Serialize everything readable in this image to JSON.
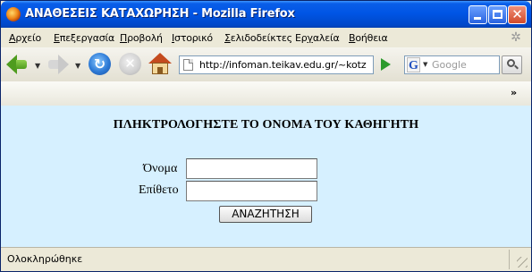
{
  "window": {
    "title": "ΑΝΑΘΕΣΕΙΣ ΚΑΤΑΧΩΡΗΣΗ - Mozilla Firefox",
    "buttons": {
      "minimize_icon": "minimize-icon",
      "maximize_icon": "maximize-icon",
      "close_icon": "close-icon"
    }
  },
  "menubar": {
    "items": [
      {
        "label": "Αρχείο",
        "u": "Α",
        "rest": "ρχείο"
      },
      {
        "label": "Επεξεργασία",
        "u": "Ε",
        "rest": "πεξεργασία"
      },
      {
        "label": "Προβολή",
        "u": "Π",
        "rest": "ροβολή"
      },
      {
        "label": "Ιστορικό",
        "u": "Ι",
        "rest": "στορικό"
      },
      {
        "label": "Σελιδοδείκτες",
        "u": "Σ",
        "rest": "ελιδοδείκτες"
      },
      {
        "label": "Εργαλεία",
        "pre": "Ερ",
        "u": "γ",
        "rest": "αλεία"
      },
      {
        "label": "Βοήθεια",
        "u": "Β",
        "rest": "οήθεια"
      }
    ]
  },
  "navbar": {
    "url": "http://infoman.teikav.edu.gr/~kotz",
    "search_engine_icon": "G",
    "search_placeholder": "Google"
  },
  "bookmarks": {
    "chevron": "»"
  },
  "form": {
    "heading": "ΠΛΗΚΤΡΟΛΟΓΗΣΤΕ ΤΟ ΟΝΟΜΑ ΤΟΥ ΚΑΘΗΓΗΤΗ",
    "name_label": "Όνομα",
    "name_value": "",
    "surname_label": "Επίθετο",
    "surname_value": "",
    "submit_label": "ΑΝΑΖΗΤΗΣΗ"
  },
  "status": {
    "text": "Ολοκληρώθηκε"
  },
  "colors": {
    "titlebar": "#0055e5",
    "content_bg": "#d6f0ff",
    "chrome_bg": "#ece9d8"
  }
}
